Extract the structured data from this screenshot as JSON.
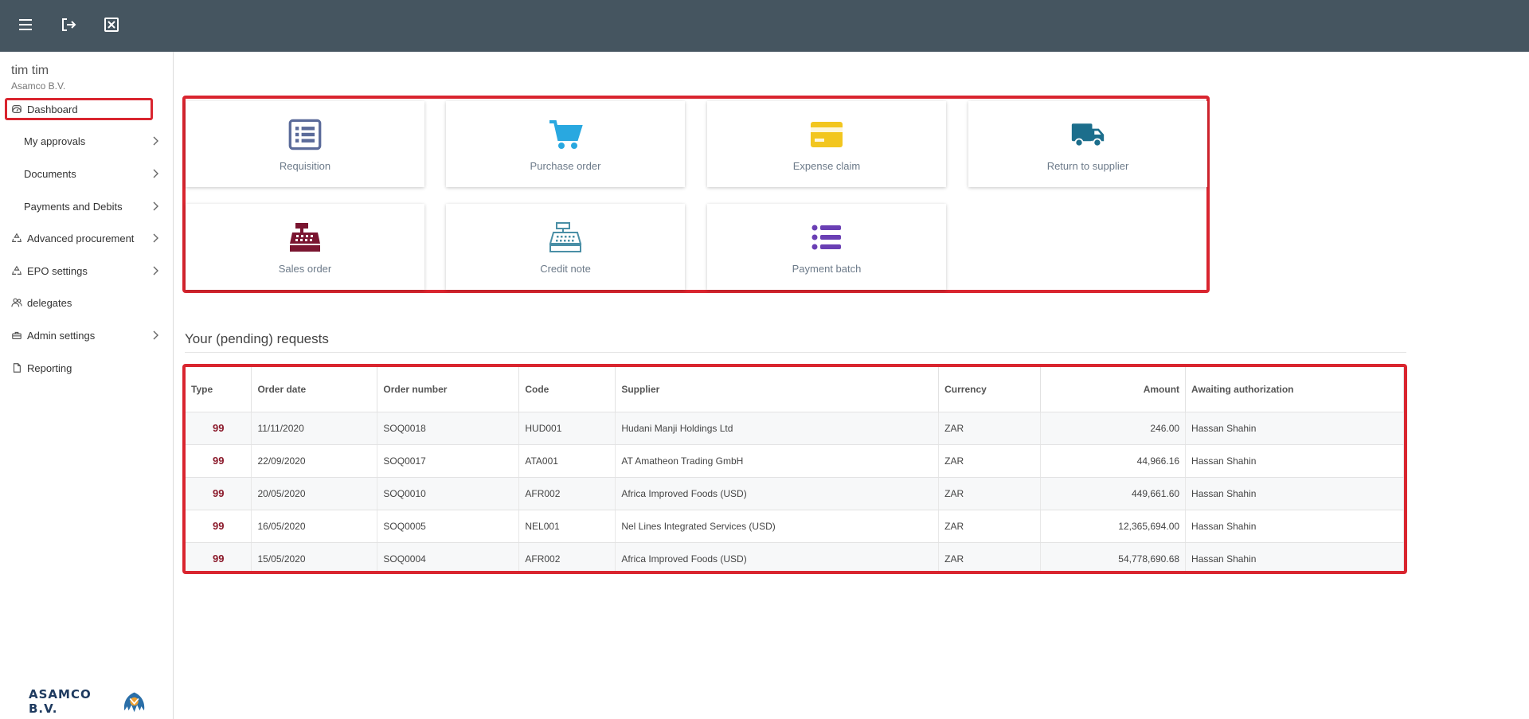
{
  "topbar": {
    "menu_icon": "menu-icon",
    "logout_icon": "logout-icon",
    "close_icon": "close-window-icon"
  },
  "user": {
    "name": "tim tim",
    "company": "Asamco B.V."
  },
  "sidebar": {
    "items": [
      {
        "label": "Dashboard",
        "icon": "dashboard-icon"
      },
      {
        "label": "My approvals"
      },
      {
        "label": "Documents"
      },
      {
        "label": "Payments and Debits"
      },
      {
        "label": "Advanced procurement",
        "icon": "recycle-icon"
      },
      {
        "label": "EPO settings",
        "icon": "recycle-icon"
      },
      {
        "label": "delegates",
        "icon": "people-icon"
      },
      {
        "label": "Admin settings",
        "icon": "toolbox-icon"
      },
      {
        "label": "Reporting",
        "icon": "document-icon"
      }
    ]
  },
  "logo": {
    "text": "ASAMCO B.V."
  },
  "tiles": [
    {
      "label": "Requisition",
      "icon": "list-icon",
      "color": "#5b6b9a"
    },
    {
      "label": "Purchase order",
      "icon": "cart-icon",
      "color": "#29a8e0"
    },
    {
      "label": "Expense claim",
      "icon": "credit-card-icon",
      "color": "#f2c61f"
    },
    {
      "label": "Return to supplier",
      "icon": "truck-icon",
      "color": "#1c6e8c"
    },
    {
      "label": "Sales order",
      "icon": "cash-register-icon",
      "color": "#7a1530"
    },
    {
      "label": "Credit note",
      "icon": "register-outline-icon",
      "color": "#4a8fa6"
    },
    {
      "label": "Payment batch",
      "icon": "bullet-list-icon",
      "color": "#6a3fb4"
    }
  ],
  "requests": {
    "title": "Your (pending) requests",
    "columns": [
      "Type",
      "Order date",
      "Order number",
      "Code",
      "Supplier",
      "Currency",
      "Amount",
      "Awaiting authorization"
    ],
    "rows": [
      {
        "type": "99",
        "date": "11/11/2020",
        "number": "SOQ0018",
        "code": "HUD001",
        "supplier": "Hudani Manji Holdings Ltd",
        "currency": "ZAR",
        "amount": "246.00",
        "awaiting": "Hassan Shahin"
      },
      {
        "type": "99",
        "date": "22/09/2020",
        "number": "SOQ0017",
        "code": "ATA001",
        "supplier": "AT Amatheon Trading GmbH",
        "currency": "ZAR",
        "amount": "44,966.16",
        "awaiting": "Hassan Shahin"
      },
      {
        "type": "99",
        "date": "20/05/2020",
        "number": "SOQ0010",
        "code": "AFR002",
        "supplier": "Africa Improved Foods (USD)",
        "currency": "ZAR",
        "amount": "449,661.60",
        "awaiting": "Hassan Shahin"
      },
      {
        "type": "99",
        "date": "16/05/2020",
        "number": "SOQ0005",
        "code": "NEL001",
        "supplier": "Nel Lines Integrated Services (USD)",
        "currency": "ZAR",
        "amount": "12,365,694.00",
        "awaiting": "Hassan Shahin"
      },
      {
        "type": "99",
        "date": "15/05/2020",
        "number": "SOQ0004",
        "code": "AFR002",
        "supplier": "Africa Improved Foods (USD)",
        "currency": "ZAR",
        "amount": "54,778,690.68",
        "awaiting": "Hassan Shahin"
      }
    ]
  },
  "colors": {
    "topbar": "#455560",
    "highlight": "#d9252f"
  }
}
